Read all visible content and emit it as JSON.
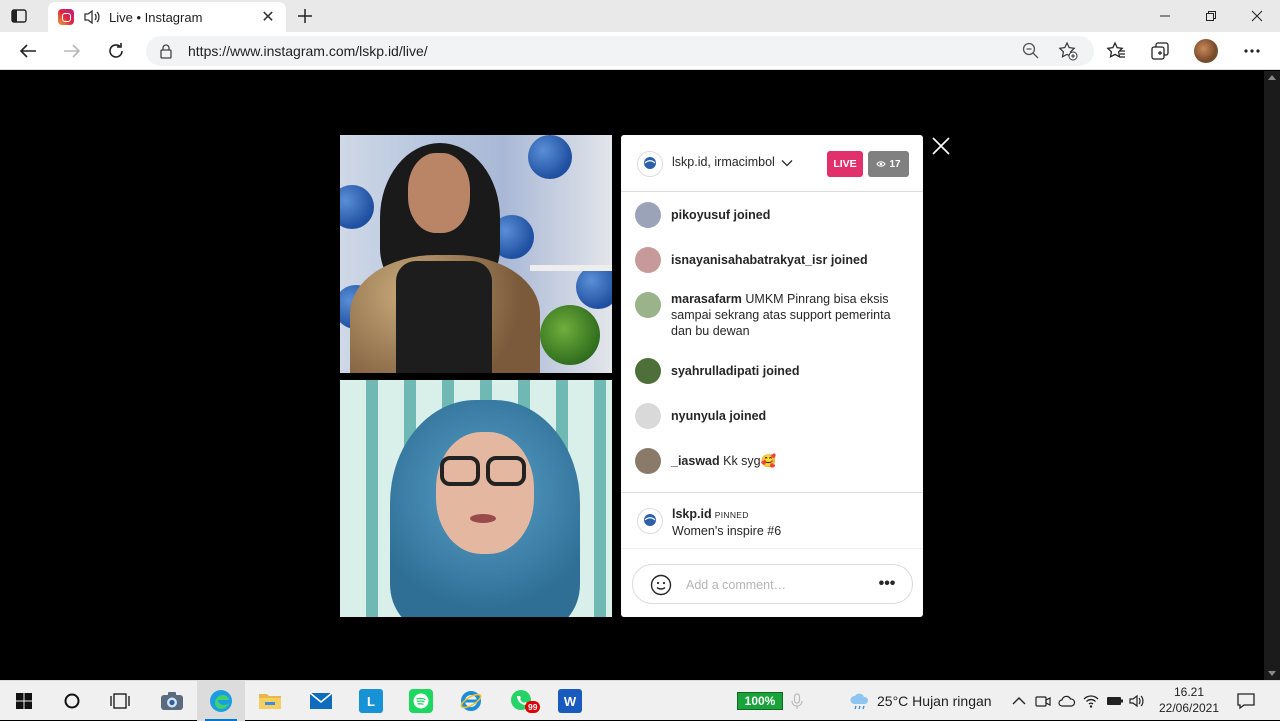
{
  "browser": {
    "tab_title": "Live • Instagram",
    "url": "https://www.instagram.com/lskp.id/live/"
  },
  "live": {
    "host_title": "lskp.id, irmacimbol",
    "live_label": "LIVE",
    "viewer_count": "17",
    "comments": [
      {
        "user": "pikoyusuf",
        "message": "joined",
        "type": "join",
        "avatar_color": "#9aa3b8"
      },
      {
        "user": "isnayanisahabatrakyat_isr",
        "message": "joined",
        "type": "join",
        "avatar_color": "#c79a9a"
      },
      {
        "user": "marasafarm",
        "message": "UMKM Pinrang bisa eksis sampai sekrang atas support pemerinta dan bu dewan",
        "type": "comment",
        "avatar_color": "#9ab38a"
      },
      {
        "user": "syahrulladipati",
        "message": "joined",
        "type": "join",
        "avatar_color": "#4f6f3a"
      },
      {
        "user": "nyunyula",
        "message": "joined",
        "type": "join",
        "avatar_color": "#d9d9d9"
      },
      {
        "user": "_iaswad",
        "message": "Kk syg🥰",
        "type": "comment",
        "avatar_color": "#8a7a6a"
      }
    ],
    "pinned": {
      "user": "lskp.id",
      "tag": "PINNED",
      "message": "Women's inspire #6"
    },
    "comment_placeholder": "Add a comment…",
    "more_label": "•••"
  },
  "taskbar": {
    "badge": "99",
    "battery": "100%",
    "weather": "25°C  Hujan ringan",
    "time": "16.21",
    "date": "22/06/2021"
  }
}
